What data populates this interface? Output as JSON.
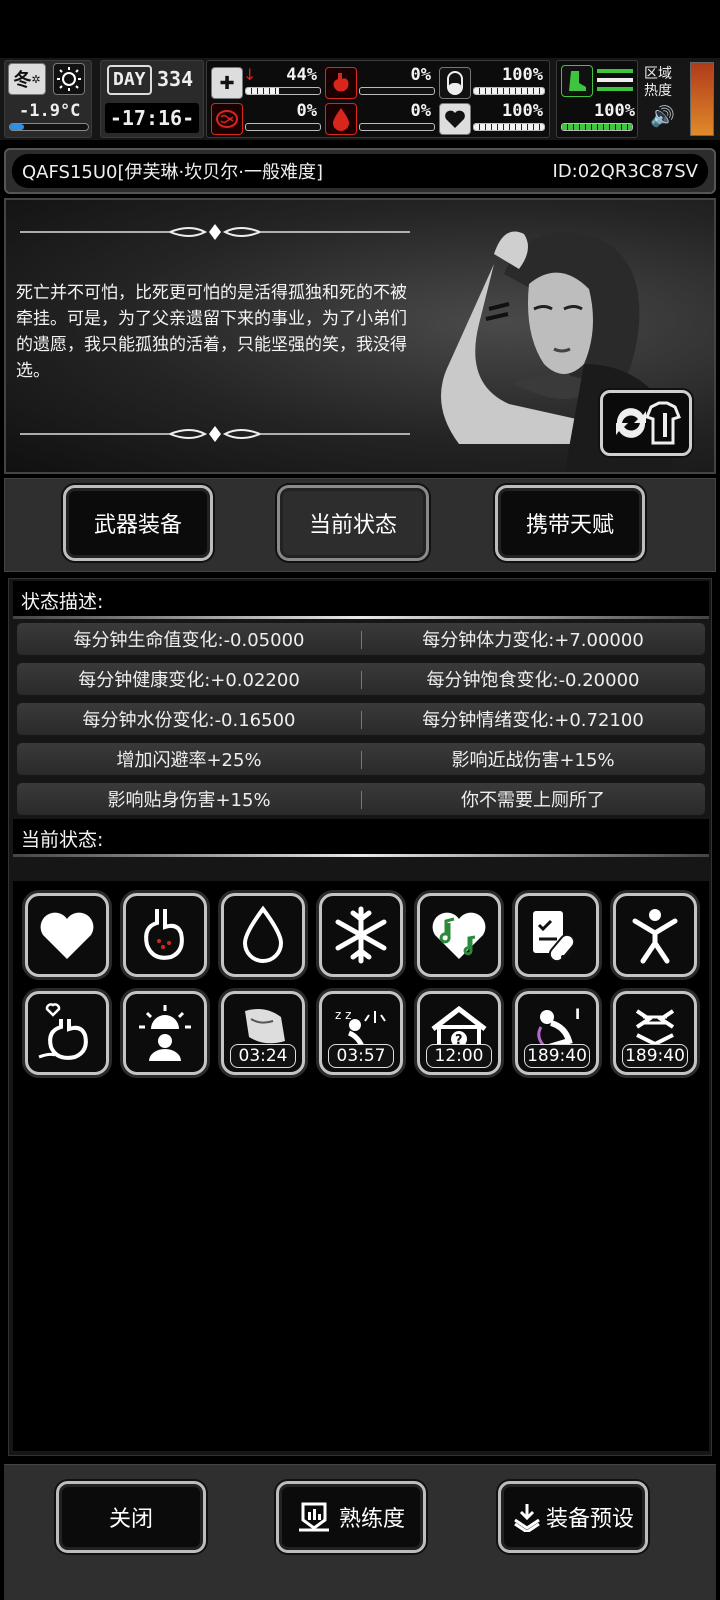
{
  "hud": {
    "season": "冬",
    "temperature": "-1.9°C",
    "day_label": "DAY",
    "day_value": "334",
    "clock": "-17:16-",
    "health_pct": "44%",
    "health_fill": 0.44,
    "sanity_pct": "0%",
    "hunger_pct": "0%",
    "thirst_pct": "0%",
    "stamina_pct": "100%",
    "mood_pct": "100%",
    "boot_pct": "100%",
    "zone_heat_label": "区域热度"
  },
  "title": {
    "name": "QAFS15U0[伊芙琳·坎贝尔·一般难度]",
    "id": "ID:02QR3C87SV"
  },
  "character": {
    "quote": "死亡并不可怕，比死更可怕的是活得孤独和死的不被牵挂。可是，为了父亲遗留下来的事业，为了小弟们的遗愿，我只能孤独的活着，只能坚强的笑，我没得选。"
  },
  "tabs": [
    {
      "label": "武器装备"
    },
    {
      "label": "当前状态"
    },
    {
      "label": "携带天赋"
    }
  ],
  "status_desc": {
    "heading": "状态描述:",
    "rows": [
      [
        "每分钟生命值变化:-0.05000",
        "每分钟体力变化:+7.00000"
      ],
      [
        "每分钟健康变化:+0.02200",
        "每分钟饱食变化:-0.20000"
      ],
      [
        "每分钟水份变化:-0.16500",
        "每分钟情绪变化:+0.72100"
      ],
      [
        "增加闪避率+25%",
        "影响近战伤害+15%"
      ],
      [
        "影响贴身伤害+15%",
        "你不需要上厕所了"
      ]
    ]
  },
  "current_status": {
    "heading": "当前状态:",
    "icons": [
      {
        "name": "heart-icon"
      },
      {
        "name": "stomach-icon"
      },
      {
        "name": "water-drop-icon"
      },
      {
        "name": "snowflake-icon"
      },
      {
        "name": "music-heart-icon"
      },
      {
        "name": "medicine-icon"
      },
      {
        "name": "stretch-person-icon"
      },
      {
        "name": "stomach-heart-icon"
      },
      {
        "name": "sunrise-person-icon"
      },
      {
        "name": "wounded-icon",
        "timer": "03:24"
      },
      {
        "name": "sleepy-icon",
        "timer": "03:57"
      },
      {
        "name": "shelter-icon",
        "timer": "12:00"
      },
      {
        "name": "vomit-icon",
        "timer": "189:40"
      },
      {
        "name": "chair-icon",
        "timer": "189:40"
      }
    ]
  },
  "bottom": {
    "close": "关闭",
    "proficiency": "熟练度",
    "preset": "装备预设"
  }
}
